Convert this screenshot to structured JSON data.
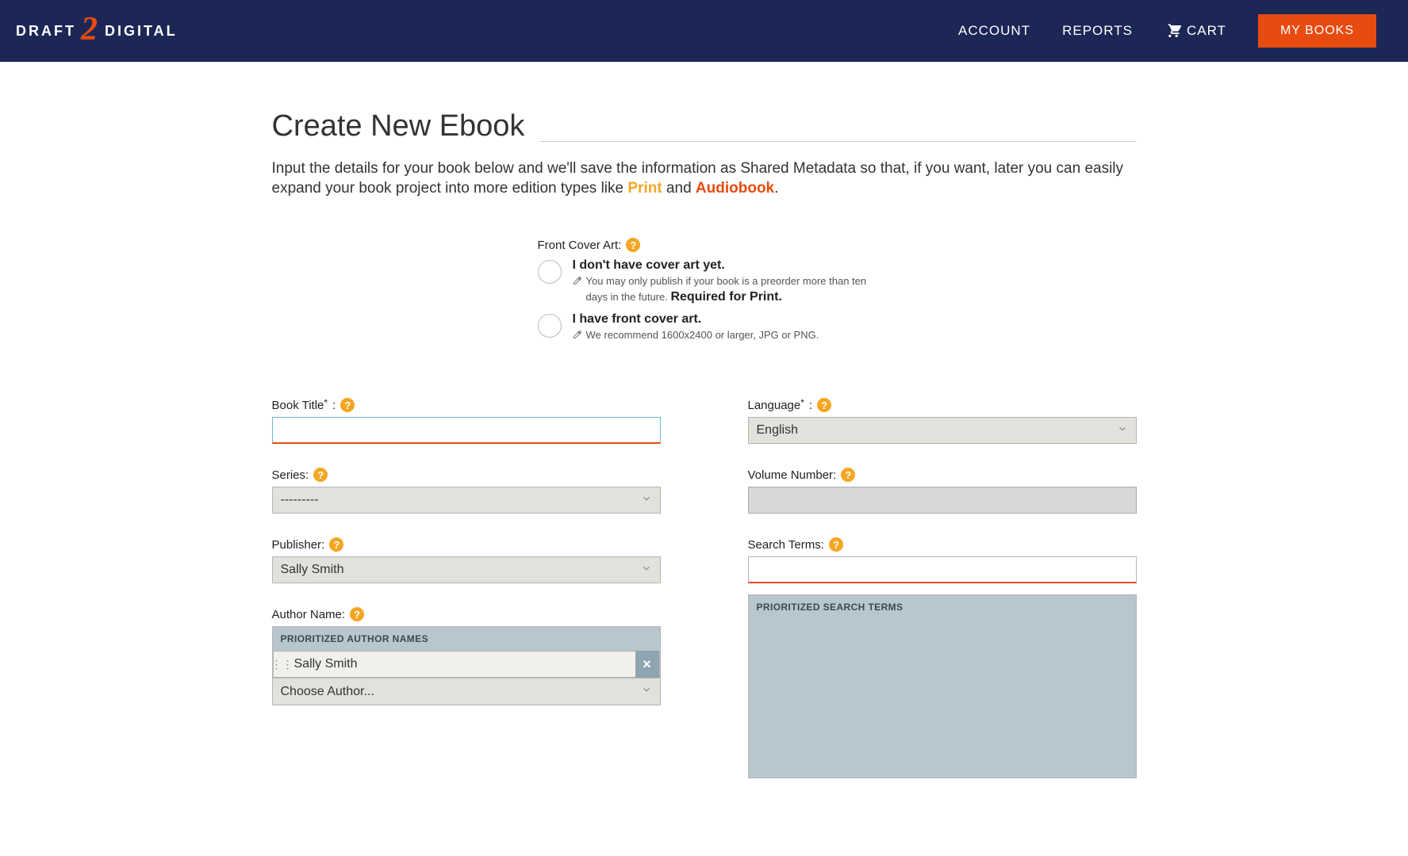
{
  "header": {
    "logo_left": "DRAFT",
    "logo_mid_glyph": "2",
    "logo_right": "DIGITAL",
    "nav": {
      "account": "ACCOUNT",
      "reports": "REPORTS",
      "cart": "CART",
      "mybooks": "MY BOOKS"
    }
  },
  "page": {
    "title": "Create New Ebook",
    "intro_pre": "Input the details for your book below and we'll save the information as Shared Metadata so that, if you want, later you can easily expand your book project into more edition types like ",
    "intro_print": "Print",
    "intro_and": " and ",
    "intro_audio": "Audiobook",
    "intro_end": "."
  },
  "cover": {
    "label": "Front Cover Art:",
    "opt1_title": "I don't have cover art yet.",
    "opt1_sub_a": "You may only publish if your book is a preorder more than ten days in the future. ",
    "opt1_sub_b": "Required for Print.",
    "opt2_title": "I have front cover art.",
    "opt2_sub": "We recommend 1600x2400 or larger, JPG or PNG."
  },
  "fields": {
    "book_title_label": "Book Title",
    "series_label": "Series:",
    "series_value": "---------",
    "publisher_label": "Publisher:",
    "publisher_value": "Sally Smith",
    "author_label": "Author Name:",
    "author_list_header": "PRIORITIZED AUTHOR NAMES",
    "author_item": "Sally Smith",
    "author_choose": "Choose Author...",
    "language_label": "Language",
    "language_value": "English",
    "volume_label": "Volume Number:",
    "search_label": "Search Terms:",
    "search_list_header": "PRIORITIZED SEARCH TERMS"
  }
}
